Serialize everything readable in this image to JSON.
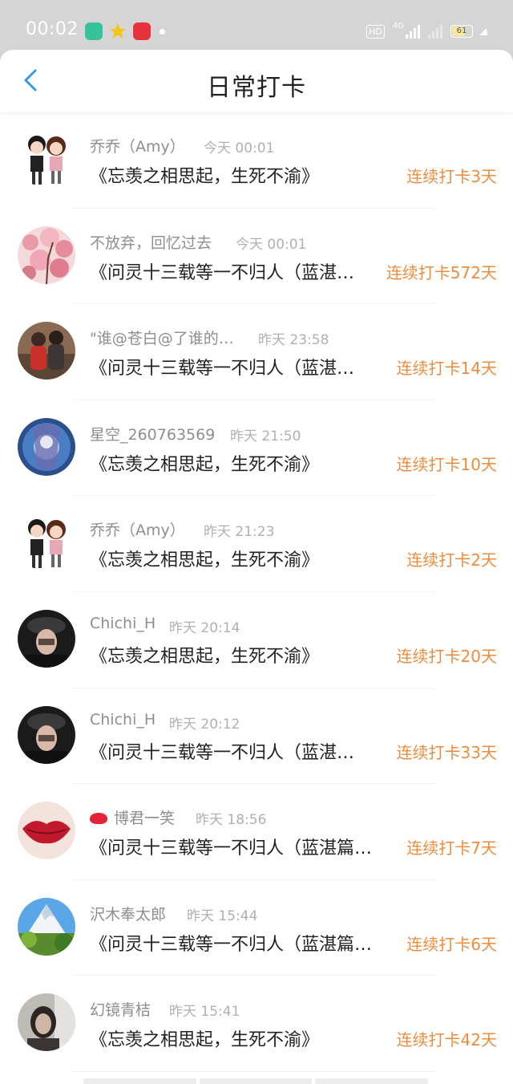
{
  "status_bar": {
    "time": "00:02",
    "hd": "HD",
    "network": "4G",
    "battery": "61"
  },
  "header": {
    "title": "日常打卡",
    "back_icon": "chevron-left-icon",
    "accent": "#2f9bf0"
  },
  "items": [
    {
      "name": "乔乔（Amy）",
      "time": "今天 00:01",
      "title": "《忘羡之相思起，生死不渝》",
      "streak": "连续打卡3天",
      "avatar": "couple-cartoon"
    },
    {
      "name": "不放弃，回忆过去",
      "time": "今天 00:01",
      "title": "《问灵十三载等一不归人（蓝湛…",
      "streak": "连续打卡572天",
      "avatar": "pink-blossoms"
    },
    {
      "name": "\"谁@苍白@了谁的…",
      "time": "昨天 23:58",
      "title": "《问灵十三载等一不归人（蓝湛…",
      "streak": "连续打卡14天",
      "avatar": "photo-two-people"
    },
    {
      "name": "星空_260763569",
      "time": "昨天 21:50",
      "title": "《忘羡之相思起，生死不渝》",
      "streak": "连续打卡10天",
      "avatar": "anime-blue"
    },
    {
      "name": "乔乔（Amy）",
      "time": "昨天 21:23",
      "title": "《忘羡之相思起，生死不渝》",
      "streak": "连续打卡2天",
      "avatar": "couple-cartoon"
    },
    {
      "name": "Chichi_H",
      "time": "昨天 20:14",
      "title": "《忘羡之相思起，生死不渝》",
      "streak": "连续打卡20天",
      "avatar": "girl-hat"
    },
    {
      "name": "Chichi_H",
      "time": "昨天 20:12",
      "title": "《问灵十三载等一不归人（蓝湛…",
      "streak": "连续打卡33天",
      "avatar": "girl-hat"
    },
    {
      "name": "博君一笑",
      "time": "昨天 18:56",
      "title": "《问灵十三载等一不归人（蓝湛篇…",
      "streak": "连续打卡7天",
      "avatar": "red-lips",
      "name_icon": "kiss-icon"
    },
    {
      "name": "沢木奉太郎",
      "time": "昨天 15:44",
      "title": "《问灵十三载等一不归人（蓝湛篇…",
      "streak": "连续打卡6天",
      "avatar": "mountain-landscape"
    },
    {
      "name": "幻镜青桔",
      "time": "昨天 15:41",
      "title": "《忘羡之相思起，生死不渝》",
      "streak": "连续打卡42天",
      "avatar": "girl-selfie"
    }
  ]
}
